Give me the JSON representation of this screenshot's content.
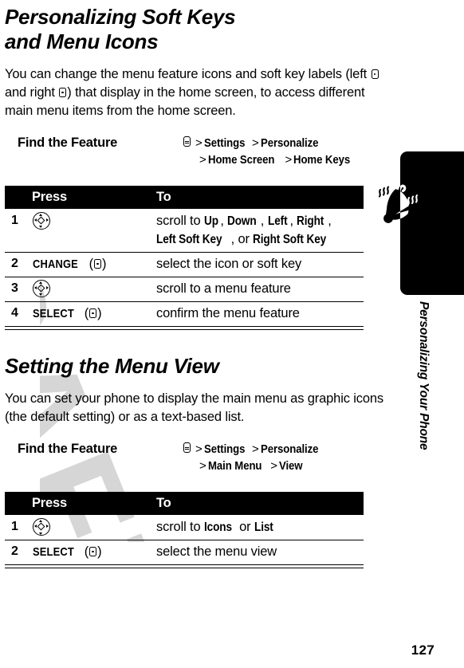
{
  "page": {
    "number": "127",
    "watermark": "DRAFT"
  },
  "side_tab": {
    "label": "Personalizing Your Phone",
    "icon": "ringing-bell-icon"
  },
  "sections": [
    {
      "title": "Personalizing Soft Keys and Menu Icons",
      "intro_part1": "You can change the menu feature icons and soft key labels (left ",
      "intro_part2": " and right ",
      "intro_part3": ") that display in the home screen, to access different main menu items from the home screen.",
      "find_feature": {
        "label": "Find the Feature",
        "menu_icon": "menu-icon",
        "line1": [
          "Settings",
          "Personalize"
        ],
        "line2": [
          "Home Screen",
          "Home Keys"
        ],
        "separator": ">"
      },
      "table": {
        "headers": {
          "num": "",
          "press": "Press",
          "to": "To"
        },
        "rows": [
          {
            "num": "1",
            "press_icon": "nav-key-icon",
            "press_label": "",
            "to_prefix": "scroll to ",
            "to_terms": [
              "Up",
              "Down",
              "Left",
              "Right",
              "Left Soft Key",
              "Right Soft Key"
            ],
            "to_conjunction": "or",
            "to_full_line1": "scroll to Up, Down, Left, Right,",
            "to_full_line2": "Left Soft Key, or Right Soft Key"
          },
          {
            "num": "2",
            "press_icon": "softkey-icon",
            "press_label": "CHANGE",
            "to_full_line1": "select the icon or soft key"
          },
          {
            "num": "3",
            "press_icon": "nav-key-icon",
            "press_label": "",
            "to_full_line1": "scroll to a menu feature"
          },
          {
            "num": "4",
            "press_icon": "softkey-icon",
            "press_label": "SELECT",
            "to_full_line1": "confirm the menu feature"
          }
        ]
      }
    },
    {
      "title": "Setting the Menu View",
      "intro": "You can set your phone to display the main menu as graphic icons (the default setting) or as a text-based list.",
      "find_feature": {
        "label": "Find the Feature",
        "menu_icon": "menu-icon",
        "line1": [
          "Settings",
          "Personalize"
        ],
        "line2": [
          "Main Menu",
          "View"
        ],
        "separator": ">"
      },
      "table": {
        "headers": {
          "num": "",
          "press": "Press",
          "to": "To"
        },
        "rows": [
          {
            "num": "1",
            "press_icon": "nav-key-icon",
            "press_label": "",
            "to_prefix": "scroll to ",
            "to_terms": [
              "Icons",
              "List"
            ],
            "to_conjunction": "or"
          },
          {
            "num": "2",
            "press_icon": "softkey-icon",
            "press_label": "SELECT",
            "to_full_line1": "select the menu view"
          }
        ]
      }
    }
  ],
  "colors": {
    "ink": "#000000",
    "paper": "#ffffff",
    "watermark": "#cfcfcf"
  }
}
